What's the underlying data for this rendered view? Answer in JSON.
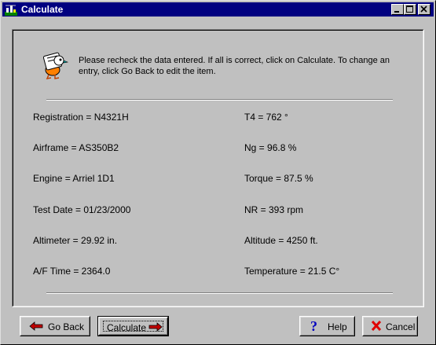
{
  "window": {
    "title": "Calculate"
  },
  "message": "Please recheck the data entered.  If all is correct, click on Calculate.  To change an entry, click Go Back to edit the item.",
  "fields_left": [
    "Registration = N4321H",
    "Airframe = AS350B2",
    "Engine = Arriel 1D1",
    "Test Date = 01/23/2000",
    "Altimeter = 29.92 in.",
    "A/F Time = 2364.0"
  ],
  "fields_right": [
    "T4 = 762 °",
    "Ng = 96.8 %",
    "Torque = 87.5 %",
    "NR = 393 rpm",
    "Altitude = 4250 ft.",
    "Temperature = 21.5 C°"
  ],
  "buttons": {
    "go_back": "Go Back",
    "calculate": "Calculate",
    "help": "Help",
    "cancel": "Cancel"
  },
  "colors": {
    "titlebar": "#000080",
    "face": "#c0c0c0",
    "arrow_red": "#c00000",
    "help_blue": "#0000c0",
    "cancel_red": "#e00000"
  }
}
